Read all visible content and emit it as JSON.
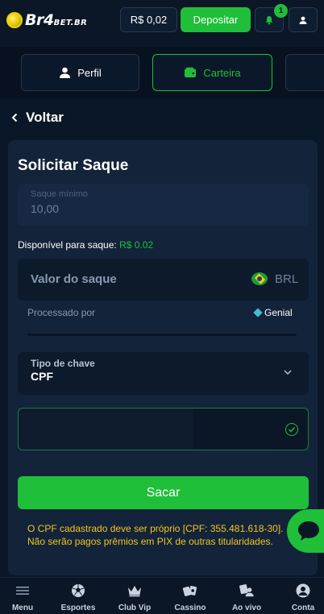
{
  "header": {
    "logo_main": "Br4",
    "logo_suffix": "BET.BR",
    "balance": "R$ 0,02",
    "deposit_label": "Depositar",
    "notification_count": "1"
  },
  "tabs": [
    {
      "label": "Perfil",
      "icon": "user-icon",
      "active": false
    },
    {
      "label": "Carteira",
      "icon": "wallet-icon",
      "active": true
    }
  ],
  "back_label": "Voltar",
  "withdraw": {
    "title": "Solicitar Saque",
    "min_label": "Saque mínimo",
    "min_value": "10,00",
    "available_label": "Disponível para saque:",
    "available_amount": "R$ 0.02",
    "amount_placeholder": "Valor do saque",
    "currency": "BRL",
    "processed_label": "Processado por",
    "processor": "Genial",
    "key_type_label": "Tipo de chave",
    "key_type_value": "CPF",
    "submit_label": "Sacar",
    "warning": "O CPF cadastrado deve ser próprio [CPF: 355.481.618-30]. Não serão pagos prêmios em PIX de outras titularidades."
  },
  "bottom_nav": [
    {
      "label": "Menu",
      "icon": "menu-icon"
    },
    {
      "label": "Esportes",
      "icon": "soccer-ball-icon"
    },
    {
      "label": "Club Vip",
      "icon": "crown-icon"
    },
    {
      "label": "Cassino",
      "icon": "cards-icon"
    },
    {
      "label": "Ao vivo",
      "icon": "live-dealer-icon"
    },
    {
      "label": "Conta",
      "icon": "account-icon"
    }
  ],
  "colors": {
    "accent": "#1fbf3a",
    "background": "#0a1728",
    "card": "#13233a",
    "warning": "#f2c61f"
  }
}
